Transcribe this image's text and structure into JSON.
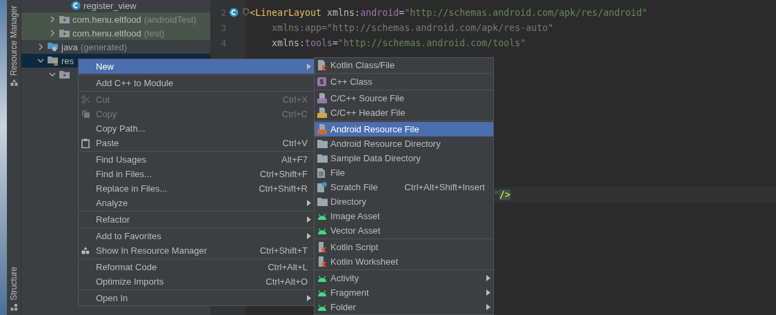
{
  "tool_strip": {
    "top_label": "Resource Manager",
    "bottom_label": "Structure"
  },
  "project_tree": [
    {
      "children": [
        {
          "children": [
            {
              "label": "register_view",
              "kind": "class",
              "selected": false
            }
          ]
        },
        {
          "label": "com.henu.eltfood",
          "hint": "(androidTest)",
          "kind": "test-package",
          "expanded": false,
          "selected": false
        },
        {
          "label": "com.henu.eltfood",
          "hint": "(test)",
          "kind": "test-package",
          "expanded": false,
          "selected": false
        }
      ]
    },
    {
      "label": "java",
      "hint": "(generated)",
      "kind": "generated-folder",
      "expanded": false,
      "selected": false
    },
    {
      "label": "res",
      "kind": "res-folder",
      "expanded": true,
      "selected": true,
      "children": [
        {
          "kind": "package",
          "expanded": true,
          "selected": false
        }
      ]
    }
  ],
  "editor": {
    "lines": [
      {
        "number": "2",
        "class_marker": true,
        "fold": true,
        "tokens": [
          {
            "text": "<LinearLayout",
            "kind": "tag"
          },
          {
            "text": " xmlns:",
            "kind": "plain"
          },
          {
            "text": "android",
            "kind": "ns"
          },
          {
            "text": "=",
            "kind": "plain"
          },
          {
            "text": "\"http://schemas.android.com/apk/res/android\"",
            "kind": "value"
          }
        ]
      },
      {
        "number": "3",
        "tokens": [
          {
            "text": "    xmlns:app=\"http://schemas.android.com/apk/res-auto\"",
            "kind": "unused"
          }
        ]
      },
      {
        "number": "4",
        "tokens": [
          {
            "text": "    xmlns:",
            "kind": "plain"
          },
          {
            "text": "tools",
            "kind": "ns"
          },
          {
            "text": "=",
            "kind": "plain"
          },
          {
            "text": "\"http://schemas.android.com/tools\"",
            "kind": "value"
          }
        ]
      }
    ],
    "caret_line": {
      "tokens": [
        {
          "text": "\"",
          "kind": "value",
          "highlight": false
        },
        {
          "text": "/>",
          "kind": "tag",
          "highlight": true
        }
      ]
    }
  },
  "context_menu": {
    "groups": [
      [
        {
          "label": "New",
          "submenu": true,
          "selected": true,
          "disabled": false
        }
      ],
      [
        {
          "label": "Add C++ to Module",
          "submenu": false,
          "selected": false,
          "disabled": false
        }
      ],
      [
        {
          "label": "Cut",
          "shortcut": "Ctrl+X",
          "kind": "scissors",
          "submenu": false,
          "selected": false,
          "disabled": true
        },
        {
          "label": "Copy",
          "shortcut": "Ctrl+C",
          "kind": "copy",
          "submenu": false,
          "selected": false,
          "disabled": true
        },
        {
          "label": "Copy Path...",
          "submenu": false,
          "selected": false,
          "disabled": false
        },
        {
          "label": "Paste",
          "shortcut": "Ctrl+V",
          "kind": "paste",
          "submenu": false,
          "selected": false,
          "disabled": false
        }
      ],
      [
        {
          "label": "Find Usages",
          "shortcut": "Alt+F7",
          "submenu": false,
          "selected": false,
          "disabled": false
        },
        {
          "label": "Find in Files...",
          "shortcut": "Ctrl+Shift+F",
          "submenu": false,
          "selected": false,
          "disabled": false
        },
        {
          "label": "Replace in Files...",
          "shortcut": "Ctrl+Shift+R",
          "submenu": false,
          "selected": false,
          "disabled": false
        },
        {
          "label": "Analyze",
          "submenu": true,
          "selected": false,
          "disabled": false
        }
      ],
      [
        {
          "label": "Refactor",
          "submenu": true,
          "selected": false,
          "disabled": false
        }
      ],
      [
        {
          "label": "Add to Favorites",
          "submenu": true,
          "selected": false,
          "disabled": false
        },
        {
          "label": "Show In Resource Manager",
          "shortcut": "Ctrl+Shift+T",
          "kind": "shapes",
          "submenu": false,
          "selected": false,
          "disabled": false
        }
      ],
      [
        {
          "label": "Reformat Code",
          "shortcut": "Ctrl+Alt+L",
          "submenu": false,
          "selected": false,
          "disabled": false
        },
        {
          "label": "Optimize Imports",
          "shortcut": "Ctrl+Alt+O",
          "submenu": false,
          "selected": false,
          "disabled": false
        }
      ],
      [
        {
          "label": "Open In",
          "submenu": true,
          "selected": false,
          "disabled": false
        }
      ]
    ]
  },
  "new_submenu": {
    "groups": [
      [
        {
          "label": "Kotlin Class/File",
          "kind": "kotlin",
          "submenu": false,
          "selected": false
        }
      ],
      [
        {
          "label": "C++ Class",
          "kind": "cpp-class",
          "submenu": false,
          "selected": false
        }
      ],
      [
        {
          "label": "C/C++ Source File",
          "kind": "c-source",
          "submenu": false,
          "selected": false
        },
        {
          "label": "C/C++ Header File",
          "kind": "c-header",
          "submenu": false,
          "selected": false
        }
      ],
      [
        {
          "label": "Android Resource File",
          "kind": "resource-file",
          "submenu": false,
          "selected": true
        },
        {
          "label": "Android Resource Directory",
          "kind": "folder",
          "submenu": false,
          "selected": false
        },
        {
          "label": "Sample Data Directory",
          "kind": "folder",
          "submenu": false,
          "selected": false
        },
        {
          "label": "File",
          "kind": "file",
          "submenu": false,
          "selected": false
        },
        {
          "label": "Scratch File",
          "shortcut": "Ctrl+Alt+Shift+Insert",
          "kind": "scratch",
          "submenu": false,
          "selected": false
        },
        {
          "label": "Directory",
          "kind": "folder",
          "submenu": false,
          "selected": false
        },
        {
          "label": "Image Asset",
          "kind": "android",
          "submenu": false,
          "selected": false
        },
        {
          "label": "Vector Asset",
          "kind": "android",
          "submenu": false,
          "selected": false
        }
      ],
      [
        {
          "label": "Kotlin Script",
          "kind": "kotlin-script",
          "submenu": false,
          "selected": false
        },
        {
          "label": "Kotlin Worksheet",
          "kind": "kotlin-script",
          "submenu": false,
          "selected": false
        }
      ],
      [
        {
          "label": "Activity",
          "kind": "android",
          "submenu": true,
          "selected": false
        },
        {
          "label": "Fragment",
          "kind": "android",
          "submenu": true,
          "selected": false
        },
        {
          "label": "Folder",
          "kind": "android",
          "submenu": true,
          "selected": false
        }
      ]
    ]
  }
}
